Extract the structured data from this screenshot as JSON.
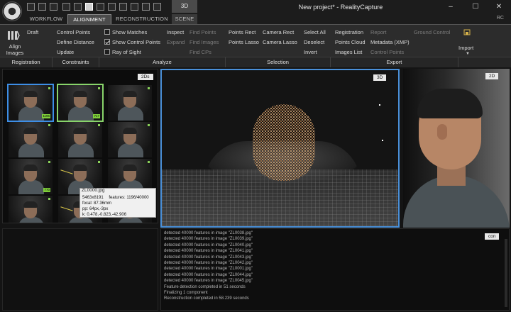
{
  "window": {
    "title": "New project* - RealityCapture",
    "context_tab": "3D",
    "controls": [
      "–",
      "☐",
      "✕"
    ]
  },
  "tabs": [
    {
      "label": "WORKFLOW",
      "active": false
    },
    {
      "label": "ALIGNMENT",
      "active": true
    },
    {
      "label": "RECONSTRUCTION",
      "active": false
    },
    {
      "label": "SCENE",
      "active": false
    }
  ],
  "user_initials": "RC",
  "ribbon": {
    "align_images": "Align Images",
    "registration": {
      "draft": "Draft",
      "update": "Update"
    },
    "constraints": {
      "control_points": "Control Points",
      "define_distance": "Define Distance"
    },
    "analyze": {
      "show_matches": "Show Matches",
      "show_control_points": "Show Control Points",
      "ray_of_sight": "Ray of Sight",
      "inspect": "Inspect",
      "expand": "Expand",
      "find_points": "Find Points",
      "find_images": "Find Images",
      "find_cps": "Find CPs"
    },
    "selection": {
      "points_rect": "Points Rect",
      "points_lasso": "Points Lasso",
      "camera_rect": "Camera Rect",
      "camera_lasso": "Camera Lasso",
      "select_all": "Select All",
      "deselect": "Deselect",
      "invert": "Invert"
    },
    "export": {
      "registration": "Registration",
      "points_cloud": "Points Cloud",
      "images_list": "Images List",
      "report": "Report",
      "metadata": "Metadata (XMP)",
      "control_points": "Control Points",
      "ground_control": "Ground Control"
    },
    "import": "Import",
    "groups": [
      "Registration",
      "Constraints",
      "Analyze",
      "Selection",
      "Export"
    ]
  },
  "panels": {
    "twods_tag": "2Ds",
    "threed_tag": "3D",
    "twod_tag": "2D",
    "console_tag": "con"
  },
  "thumbnails": [
    {
      "badge": "1196",
      "selected": "blue"
    },
    {
      "badge": "717",
      "selected": "green"
    },
    {
      "badge": "",
      "selected": ""
    },
    {
      "badge": "",
      "selected": ""
    },
    {
      "badge": "",
      "selected": ""
    },
    {
      "badge": "",
      "selected": ""
    },
    {
      "badge": "770",
      "selected": ""
    },
    {
      "badge": "538",
      "selected": ""
    },
    {
      "badge": "1",
      "selected": ""
    },
    {
      "badge": "1",
      "selected": ""
    },
    {
      "badge": "",
      "selected": ""
    },
    {
      "badge": "",
      "selected": ""
    },
    {
      "badge": "",
      "selected": ""
    },
    {
      "badge": "",
      "selected": ""
    },
    {
      "badge": "",
      "selected": ""
    }
  ],
  "tooltip": {
    "file": "ZL0000.jpg",
    "resolution": "5463x8191",
    "features": "features: 1196/40000",
    "focal": "focal: 87.36mm",
    "pp": "pp: 64px,-3px",
    "k": "k: 0.478,-0.823,-42.906"
  },
  "console": [
    "detected 40000 features in image \"ZL0038.jpg\"",
    "detected 40000 features in image \"ZL0039.jpg\"",
    "detected 40000 features in image \"ZL0040.jpg\"",
    "detected 40000 features in image \"ZL0041.jpg\"",
    "detected 40000 features in image \"ZL0043.jpg\"",
    "detected 40000 features in image \"ZL0042.jpg\"",
    "detected 40000 features in image \"ZL0001.jpg\"",
    "detected 40000 features in image \"ZL0044.jpg\"",
    "detected 40000 features in image \"ZL0045.jpg\"",
    "Feature detection completed in 51 seconds",
    "Finalizing 1 component",
    "Reconstruction completed in 58.239 seconds"
  ]
}
